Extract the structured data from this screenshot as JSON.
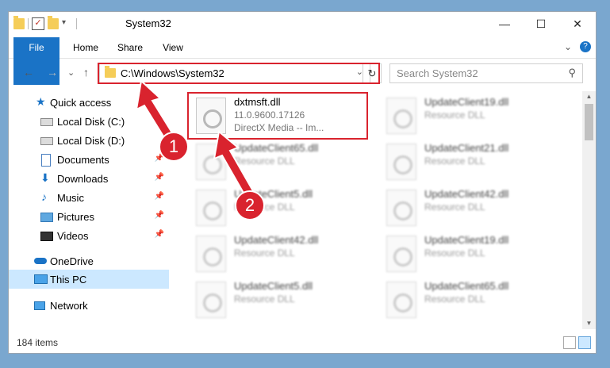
{
  "window": {
    "title": "System32",
    "close_glyph": "✕",
    "max_glyph": "☐",
    "min_glyph": "—"
  },
  "ribbon": {
    "tabs": [
      "File",
      "Home",
      "Share",
      "View"
    ],
    "expand_glyph": "⌄",
    "help_glyph": "?"
  },
  "nav": {
    "back": "←",
    "forward": "→",
    "recent": "⌄",
    "up": "↑"
  },
  "address": {
    "path": "C:\\Windows\\System32",
    "dropdown": "⌄",
    "refresh": "↻"
  },
  "search": {
    "placeholder": "Search System32",
    "icon": "⚲"
  },
  "sidebar": {
    "items": [
      {
        "label": "Quick access",
        "icon": "star-icon",
        "pinned": false
      },
      {
        "label": "Local Disk (C:)",
        "icon": "drive-icon",
        "pinned": false
      },
      {
        "label": "Local Disk (D:)",
        "icon": "drive-icon",
        "pinned": false
      },
      {
        "label": "Documents",
        "icon": "document-icon",
        "pinned": true
      },
      {
        "label": "Downloads",
        "icon": "download-icon",
        "pinned": true
      },
      {
        "label": "Music",
        "icon": "music-icon",
        "pinned": true
      },
      {
        "label": "Pictures",
        "icon": "picture-icon",
        "pinned": true
      },
      {
        "label": "Videos",
        "icon": "video-icon",
        "pinned": true
      },
      {
        "label": "OneDrive",
        "icon": "cloud-icon",
        "pinned": false
      },
      {
        "label": "This PC",
        "icon": "computer-icon",
        "pinned": false,
        "selected": true
      },
      {
        "label": "Network",
        "icon": "network-icon",
        "pinned": false
      }
    ],
    "pin_glyph": "📌"
  },
  "files": {
    "highlighted": {
      "name": "dxtmsft.dll",
      "version": "11.0.9600.17126",
      "description": "DirectX Media -- Im..."
    },
    "blurred": [
      {
        "name": "UpdateClient19.dll",
        "type": "Resource DLL"
      },
      {
        "name": "UpdateClient65.dll",
        "type": "Resource DLL"
      },
      {
        "name": "UpdateClient21.dll",
        "type": "Resource DLL"
      },
      {
        "name": "UpdateClient5.dll",
        "type": "Resource DLL"
      },
      {
        "name": "UpdateClient42.dll",
        "type": "Resource DLL"
      },
      {
        "name": "UpdateClient42.dll",
        "type": "Resource DLL"
      },
      {
        "name": "UpdateClient19.dll",
        "type": "Resource DLL"
      },
      {
        "name": "UpdateClient5.dll",
        "type": "Resource DLL"
      },
      {
        "name": "UpdateClient65.dll",
        "type": "Resource DLL"
      }
    ]
  },
  "status": {
    "item_count": "184 items"
  },
  "annotations": {
    "badge1": "1",
    "badge2": "2"
  },
  "colors": {
    "highlight": "#d9232e",
    "accent": "#1a73c6",
    "selection": "#cce8ff"
  }
}
